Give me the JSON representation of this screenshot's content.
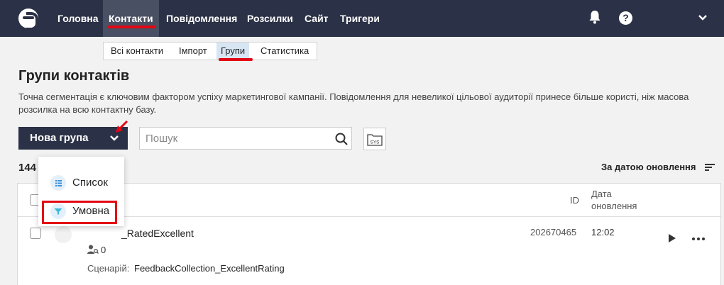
{
  "nav": {
    "items": [
      {
        "label": "Головна"
      },
      {
        "label": "Контакти"
      },
      {
        "label": "Повідомлення"
      },
      {
        "label": "Розсилки"
      },
      {
        "label": "Сайт"
      },
      {
        "label": "Тригери"
      }
    ],
    "help_label": "?"
  },
  "subtabs": [
    {
      "label": "Всі контакти"
    },
    {
      "label": "Імпорт"
    },
    {
      "label": "Групи"
    },
    {
      "label": "Статистика"
    }
  ],
  "page": {
    "title": "Групи контактів",
    "description": "Точна сегментація є ключовим фактором успіху маркетингової кампанії. Повідомлення для невеликої цільової аудиторії принесе більше користі, ніж масова розсилка на всю контактну базу."
  },
  "toolbar": {
    "new_group_label": "Нова група",
    "search_placeholder": "Пошук",
    "sys_label": "SYS"
  },
  "list": {
    "count": "144",
    "sort_label": "За датою оновлення"
  },
  "table": {
    "col_id": "ID",
    "col_date_line1": "Дата",
    "col_date_line2": "оновлення",
    "rows": [
      {
        "name": "_RatedExcellent",
        "contacts": "0",
        "scenario_label": "Сценарій:",
        "scenario_value": "FeedbackCollection_ExcellentRating",
        "id": "202670465",
        "time": "12:02"
      }
    ]
  },
  "dropdown": {
    "items": [
      {
        "label": "Список",
        "icon": "list-icon"
      },
      {
        "label": "Умовна",
        "icon": "filter-icon"
      }
    ]
  },
  "colors": {
    "nav_bg": "#2b3146",
    "accent_red": "#e30613",
    "active_subtab": "#d8e6f3"
  }
}
